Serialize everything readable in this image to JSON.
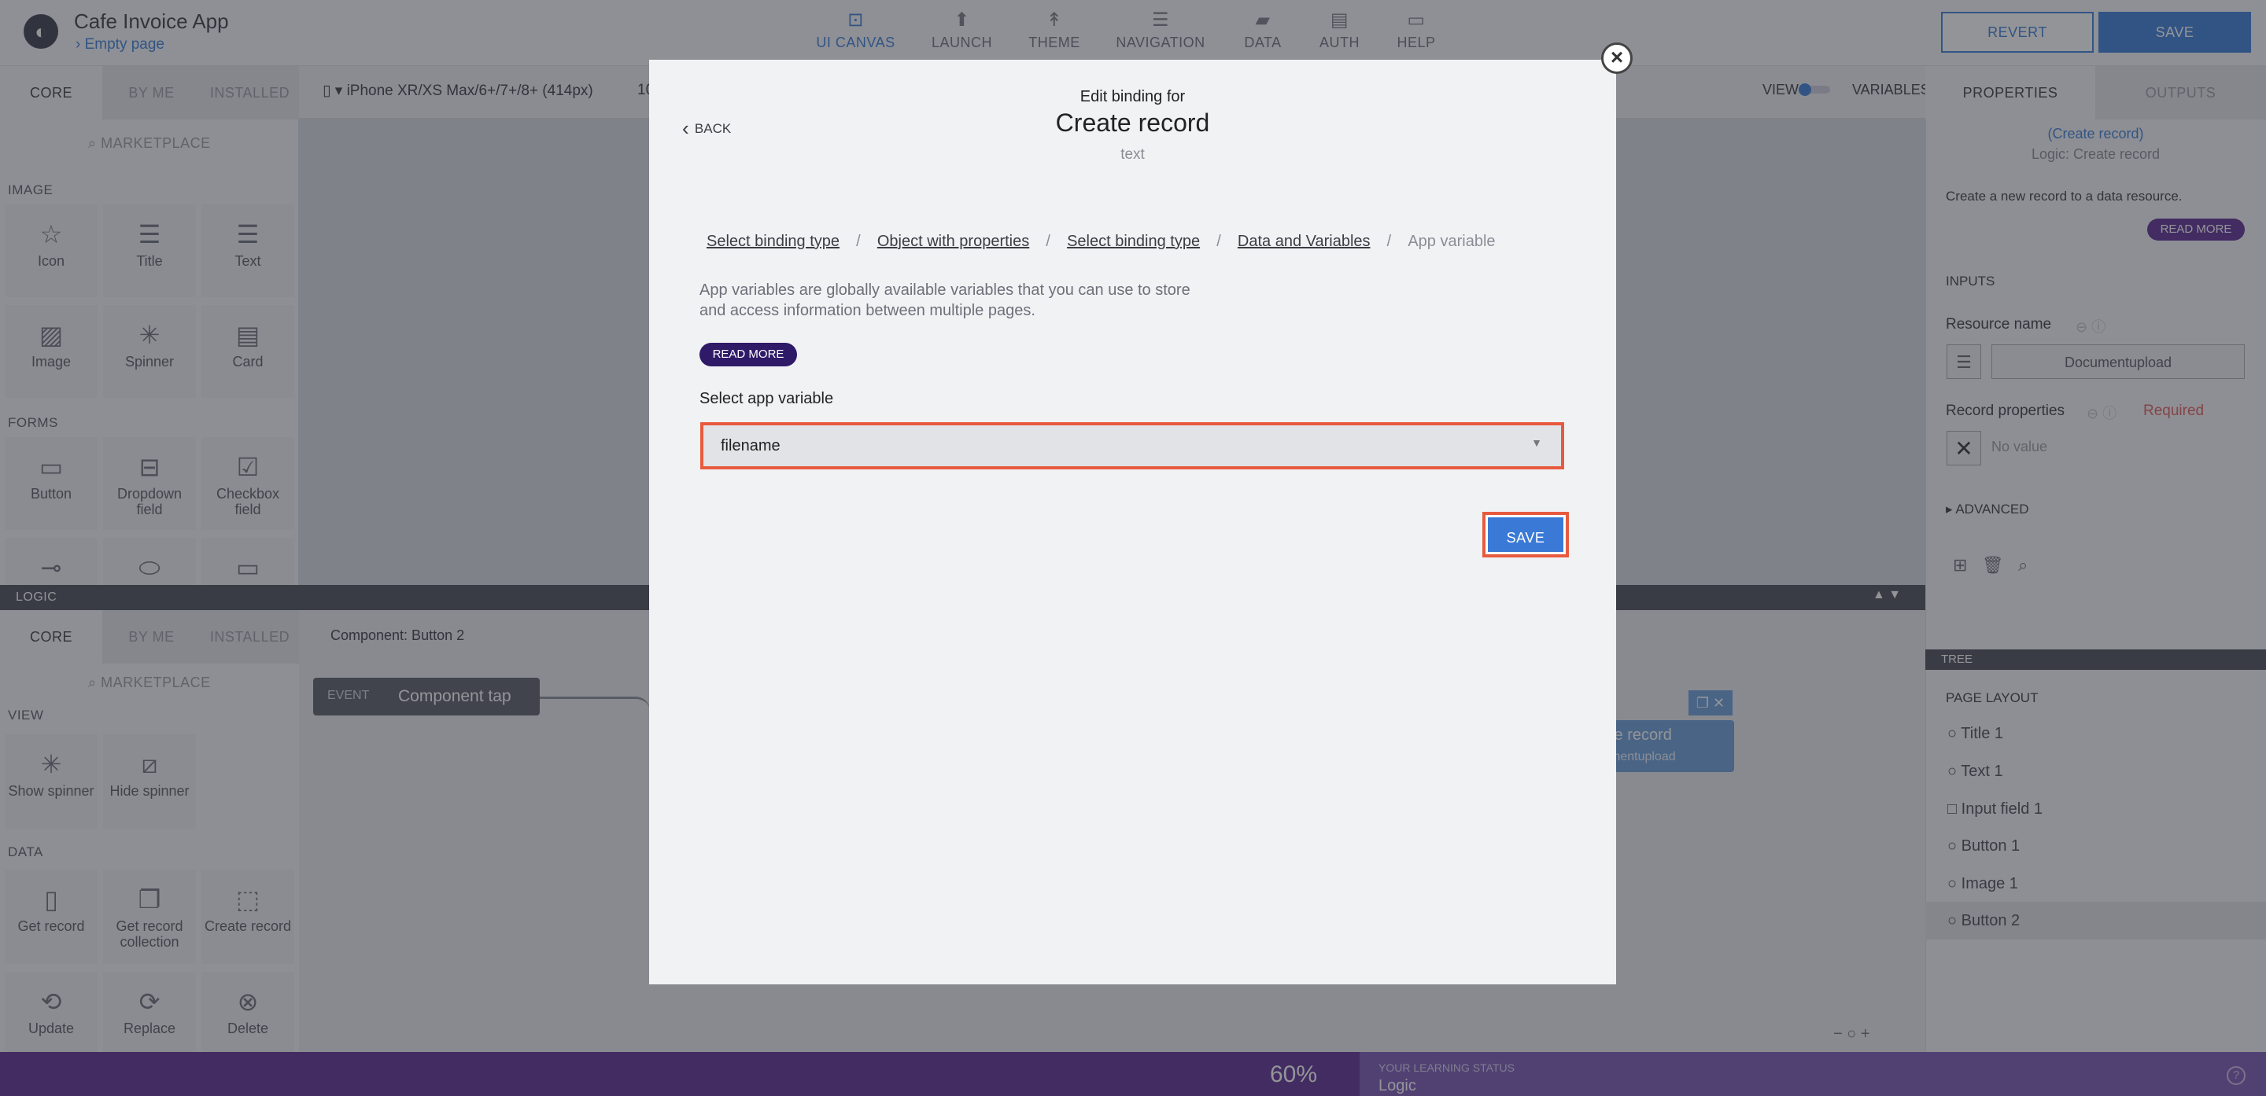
{
  "app": {
    "title": "Cafe Invoice App",
    "page": "Empty page"
  },
  "nav": [
    {
      "label": "UI CANVAS",
      "icon": "canvas-icon"
    },
    {
      "label": "LAUNCH",
      "icon": "launch-icon"
    },
    {
      "label": "THEME",
      "icon": "theme-icon"
    },
    {
      "label": "NAVIGATION",
      "icon": "navigation-icon"
    },
    {
      "label": "DATA",
      "icon": "data-icon"
    },
    {
      "label": "AUTH",
      "icon": "auth-icon"
    },
    {
      "label": "HELP",
      "icon": "help-icon"
    }
  ],
  "toolbar": {
    "revert": "REVERT",
    "save": "SAVE"
  },
  "device": {
    "label": "iPhone XR/XS Max/6+/7+/8+ (414px)",
    "zoom": "10"
  },
  "view_toggle": {
    "view": "VIEW",
    "variables": "VARIABLES"
  },
  "left": {
    "tabs": [
      "CORE",
      "BY ME",
      "INSTALLED"
    ],
    "marketplace": "MARKETPLACE",
    "image_section": "IMAGE",
    "image_tiles": [
      "Icon",
      "Title",
      "Text",
      "Image",
      "Spinner",
      "Card"
    ],
    "forms_section": "FORMS",
    "form_tiles": [
      "Button",
      "Dropdown field",
      "Checkbox field"
    ]
  },
  "logic": {
    "bar_label": "LOGIC",
    "tabs": [
      "CORE",
      "BY ME",
      "INSTALLED"
    ],
    "marketplace": "MARKETPLACE",
    "component": "Component: Button 2",
    "view_section": "VIEW",
    "view_tiles": [
      "Show spinner",
      "Hide spinner"
    ],
    "data_section": "DATA",
    "data_tiles": [
      "Get record",
      "Get record collection",
      "Create record",
      "Update",
      "Replace",
      "Delete"
    ],
    "event_tag": "EVENT",
    "event_name": "Component tap",
    "node_title": "te record",
    "node_sub": "mentupload"
  },
  "right": {
    "tabs": [
      "PROPERTIES",
      "OUTPUTS"
    ],
    "link": "(Create record)",
    "subtitle": "Logic: Create record",
    "description": "Create a new record to a data resource.",
    "read_more": "READ MORE",
    "inputs_label": "INPUTS",
    "resource_label": "Resource name",
    "resource_value": "Documentupload",
    "record_label": "Record properties",
    "required": "Required",
    "no_value": "No value",
    "advanced": "ADVANCED",
    "tree_label": "TREE",
    "page_layout": "PAGE LAYOUT",
    "tree_items": [
      "Title 1",
      "Text 1",
      "Input field 1",
      "Button 1",
      "Image 1",
      "Button 2"
    ]
  },
  "footer": {
    "percent": "60%",
    "status_label": "YOUR LEARNING STATUS",
    "status_value": "Logic"
  },
  "modal": {
    "back": "BACK",
    "heading_small": "Edit binding for",
    "heading": "Create record",
    "type": "text",
    "breadcrumbs": [
      "Select binding type",
      "Object with properties",
      "Select binding type",
      "Data and Variables"
    ],
    "breadcrumb_current": "App variable",
    "description": "App variables are globally available variables that you can use to store and access information between multiple pages.",
    "read_more": "READ MORE",
    "select_label": "Select app variable",
    "select_value": "filename",
    "save": "SAVE"
  }
}
